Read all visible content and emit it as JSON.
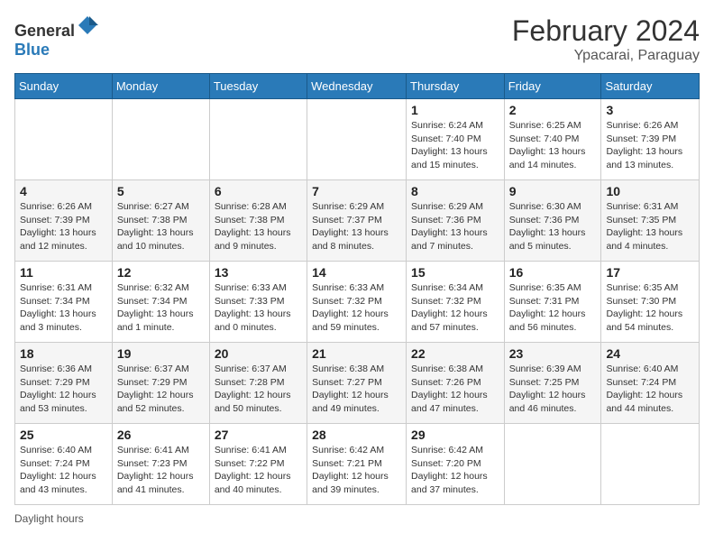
{
  "header": {
    "logo_general": "General",
    "logo_blue": "Blue",
    "month_title": "February 2024",
    "location": "Ypacarai, Paraguay"
  },
  "days_of_week": [
    "Sunday",
    "Monday",
    "Tuesday",
    "Wednesday",
    "Thursday",
    "Friday",
    "Saturday"
  ],
  "footer": {
    "daylight_label": "Daylight hours"
  },
  "weeks": [
    [
      {
        "day": "",
        "info": ""
      },
      {
        "day": "",
        "info": ""
      },
      {
        "day": "",
        "info": ""
      },
      {
        "day": "",
        "info": ""
      },
      {
        "day": "1",
        "info": "Sunrise: 6:24 AM\nSunset: 7:40 PM\nDaylight: 13 hours and 15 minutes."
      },
      {
        "day": "2",
        "info": "Sunrise: 6:25 AM\nSunset: 7:40 PM\nDaylight: 13 hours and 14 minutes."
      },
      {
        "day": "3",
        "info": "Sunrise: 6:26 AM\nSunset: 7:39 PM\nDaylight: 13 hours and 13 minutes."
      }
    ],
    [
      {
        "day": "4",
        "info": "Sunrise: 6:26 AM\nSunset: 7:39 PM\nDaylight: 13 hours and 12 minutes."
      },
      {
        "day": "5",
        "info": "Sunrise: 6:27 AM\nSunset: 7:38 PM\nDaylight: 13 hours and 10 minutes."
      },
      {
        "day": "6",
        "info": "Sunrise: 6:28 AM\nSunset: 7:38 PM\nDaylight: 13 hours and 9 minutes."
      },
      {
        "day": "7",
        "info": "Sunrise: 6:29 AM\nSunset: 7:37 PM\nDaylight: 13 hours and 8 minutes."
      },
      {
        "day": "8",
        "info": "Sunrise: 6:29 AM\nSunset: 7:36 PM\nDaylight: 13 hours and 7 minutes."
      },
      {
        "day": "9",
        "info": "Sunrise: 6:30 AM\nSunset: 7:36 PM\nDaylight: 13 hours and 5 minutes."
      },
      {
        "day": "10",
        "info": "Sunrise: 6:31 AM\nSunset: 7:35 PM\nDaylight: 13 hours and 4 minutes."
      }
    ],
    [
      {
        "day": "11",
        "info": "Sunrise: 6:31 AM\nSunset: 7:34 PM\nDaylight: 13 hours and 3 minutes."
      },
      {
        "day": "12",
        "info": "Sunrise: 6:32 AM\nSunset: 7:34 PM\nDaylight: 13 hours and 1 minute."
      },
      {
        "day": "13",
        "info": "Sunrise: 6:33 AM\nSunset: 7:33 PM\nDaylight: 13 hours and 0 minutes."
      },
      {
        "day": "14",
        "info": "Sunrise: 6:33 AM\nSunset: 7:32 PM\nDaylight: 12 hours and 59 minutes."
      },
      {
        "day": "15",
        "info": "Sunrise: 6:34 AM\nSunset: 7:32 PM\nDaylight: 12 hours and 57 minutes."
      },
      {
        "day": "16",
        "info": "Sunrise: 6:35 AM\nSunset: 7:31 PM\nDaylight: 12 hours and 56 minutes."
      },
      {
        "day": "17",
        "info": "Sunrise: 6:35 AM\nSunset: 7:30 PM\nDaylight: 12 hours and 54 minutes."
      }
    ],
    [
      {
        "day": "18",
        "info": "Sunrise: 6:36 AM\nSunset: 7:29 PM\nDaylight: 12 hours and 53 minutes."
      },
      {
        "day": "19",
        "info": "Sunrise: 6:37 AM\nSunset: 7:29 PM\nDaylight: 12 hours and 52 minutes."
      },
      {
        "day": "20",
        "info": "Sunrise: 6:37 AM\nSunset: 7:28 PM\nDaylight: 12 hours and 50 minutes."
      },
      {
        "day": "21",
        "info": "Sunrise: 6:38 AM\nSunset: 7:27 PM\nDaylight: 12 hours and 49 minutes."
      },
      {
        "day": "22",
        "info": "Sunrise: 6:38 AM\nSunset: 7:26 PM\nDaylight: 12 hours and 47 minutes."
      },
      {
        "day": "23",
        "info": "Sunrise: 6:39 AM\nSunset: 7:25 PM\nDaylight: 12 hours and 46 minutes."
      },
      {
        "day": "24",
        "info": "Sunrise: 6:40 AM\nSunset: 7:24 PM\nDaylight: 12 hours and 44 minutes."
      }
    ],
    [
      {
        "day": "25",
        "info": "Sunrise: 6:40 AM\nSunset: 7:24 PM\nDaylight: 12 hours and 43 minutes."
      },
      {
        "day": "26",
        "info": "Sunrise: 6:41 AM\nSunset: 7:23 PM\nDaylight: 12 hours and 41 minutes."
      },
      {
        "day": "27",
        "info": "Sunrise: 6:41 AM\nSunset: 7:22 PM\nDaylight: 12 hours and 40 minutes."
      },
      {
        "day": "28",
        "info": "Sunrise: 6:42 AM\nSunset: 7:21 PM\nDaylight: 12 hours and 39 minutes."
      },
      {
        "day": "29",
        "info": "Sunrise: 6:42 AM\nSunset: 7:20 PM\nDaylight: 12 hours and 37 minutes."
      },
      {
        "day": "",
        "info": ""
      },
      {
        "day": "",
        "info": ""
      }
    ]
  ]
}
